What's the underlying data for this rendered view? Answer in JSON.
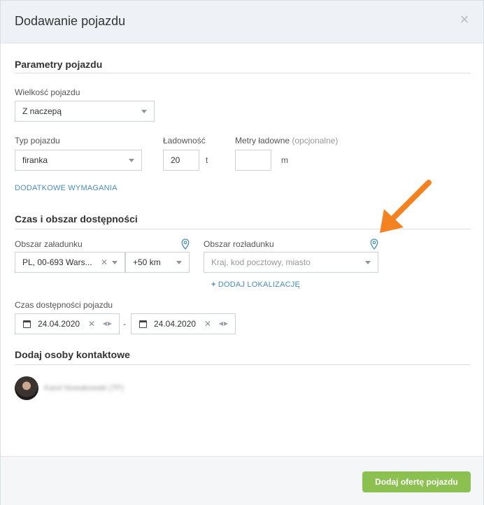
{
  "modal": {
    "title": "Dodawanie pojazdu",
    "close_symbol": "×"
  },
  "vehicle_params": {
    "section_title": "Parametry pojazdu",
    "size_label": "Wielkość pojazdu",
    "size_value": "Z naczepą",
    "type_label": "Typ pojazdu",
    "type_value": "firanka",
    "capacity_label": "Ładowność",
    "capacity_value": "20",
    "capacity_unit": "t",
    "meters_label": "Metry ładowne",
    "meters_optional": "(opcjonalne)",
    "meters_value": "",
    "meters_unit": "m",
    "extra_link": "DODATKOWE WYMAGANIA"
  },
  "availability": {
    "section_title": "Czas i obszar dostępności",
    "loading_label": "Obszar załadunku",
    "loading_value": "PL, 00-693 Wars...",
    "radius_value": "+50 km",
    "unloading_label": "Obszar rozładunku",
    "unloading_placeholder": "Kraj, kod pocztowy, miasto",
    "add_location": "DODAJ LOKALIZACJĘ",
    "add_location_plus": "+",
    "time_label": "Czas dostępności pojazdu",
    "date_from": "24.04.2020",
    "date_to": "24.04.2020",
    "date_separator": "-"
  },
  "contacts": {
    "section_title": "Dodaj osoby kontaktowe",
    "person_name": "Karol Nowakowski (TF)"
  },
  "footer": {
    "submit_label": "Dodaj ofertę pojazdu"
  },
  "colors": {
    "accent_green": "#8cc152",
    "link_blue": "#4a8db8",
    "arrow_orange": "#f58220"
  }
}
